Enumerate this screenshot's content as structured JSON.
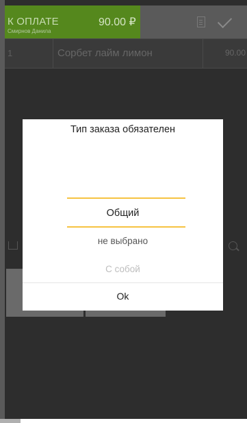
{
  "topbar": {
    "pay_title": "К ОПЛАТЕ",
    "user_name": "Смирнов Данила",
    "total": "90.00 ₽",
    "doc_icon": "receipt-icon",
    "check_icon": "check-icon"
  },
  "order": {
    "rows": [
      {
        "num": "1",
        "name": "Сорбет лайм лимон",
        "price": "90.00"
      }
    ]
  },
  "dialog": {
    "title": "Тип заказа обязателен",
    "options": [
      "Общий",
      "не выбрано",
      "С собой"
    ],
    "selected": "Общий",
    "ok_label": "Ok",
    "accent_color": "#f6c341"
  },
  "colors": {
    "pay_green": "#55881d",
    "background": "#2d2d2d"
  }
}
